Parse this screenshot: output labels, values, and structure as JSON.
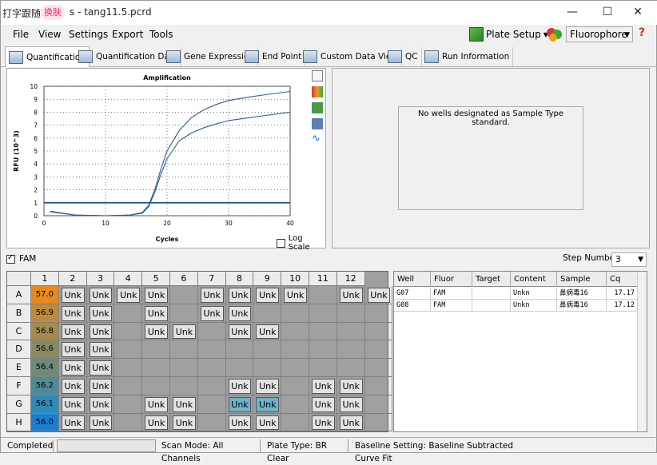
{
  "title": {
    "app_prefix": "打字跟随",
    "skin_pill": "换肤",
    "file": "s - tang11.5.pcrd"
  },
  "window_buttons": {
    "minimize": "—",
    "maximize": "☐",
    "close": "✕"
  },
  "menu": {
    "file": "File",
    "view": "View",
    "settings": "Settings",
    "export": "Export",
    "tools": "Tools"
  },
  "toolbar": {
    "plate_setup": "Plate Setup",
    "fluorophore": "Fluorophore",
    "help": "?"
  },
  "tabs": [
    "Quantification",
    "Quantification Data",
    "Gene Expression",
    "End Point",
    "Custom Data View",
    "QC",
    "Run Information"
  ],
  "chart": {
    "log_scale": "Log Scale"
  },
  "chart_data": {
    "type": "line",
    "title": "Amplification",
    "xlabel": "Cycles",
    "ylabel": "RFU (10^3)",
    "xlim": [
      0,
      40
    ],
    "ylim": [
      0,
      10
    ],
    "xticks": [
      0,
      10,
      20,
      30,
      40
    ],
    "yticks": [
      0,
      1,
      2,
      3,
      4,
      5,
      6,
      7,
      8,
      9,
      10
    ],
    "grid": true,
    "series": [
      {
        "x": [
          1,
          5,
          10,
          14,
          16,
          17,
          18,
          19,
          20,
          22,
          24,
          26,
          28,
          30,
          33,
          36,
          40
        ],
        "values": [
          0.35,
          0.05,
          0.0,
          0.05,
          0.25,
          0.8,
          2.0,
          3.6,
          5.0,
          6.6,
          7.6,
          8.2,
          8.6,
          8.9,
          9.15,
          9.35,
          9.6
        ]
      },
      {
        "x": [
          1,
          5,
          10,
          14,
          16,
          17,
          18,
          19,
          20,
          22,
          24,
          26,
          28,
          30,
          33,
          36,
          40
        ],
        "values": [
          0.3,
          0.05,
          0.0,
          0.05,
          0.2,
          0.7,
          1.8,
          3.2,
          4.4,
          5.8,
          6.4,
          6.8,
          7.1,
          7.35,
          7.55,
          7.75,
          8.0
        ]
      }
    ],
    "threshold": 1.0
  },
  "message": "No wells designated as Sample Type standard.",
  "fam_label": "FAM",
  "step_number": {
    "label": "Step Number:",
    "value": "3"
  },
  "plate": {
    "columns": [
      "1",
      "2",
      "3",
      "4",
      "5",
      "6",
      "7",
      "8",
      "9",
      "10",
      "11",
      "12"
    ],
    "rows": [
      {
        "letter": "A",
        "temp": "57.0",
        "color": "#e8891e",
        "wells": [
          "Unk",
          "Unk",
          "Unk",
          "Unk",
          "",
          "Unk",
          "Unk",
          "Unk",
          "Unk",
          "",
          "Unk",
          "Unk"
        ]
      },
      {
        "letter": "B",
        "temp": "56.9",
        "color": "#c08a3a",
        "wells": [
          "Unk",
          "Unk",
          "",
          "Unk",
          "",
          "Unk",
          "Unk",
          "",
          "",
          "",
          "",
          ""
        ]
      },
      {
        "letter": "C",
        "temp": "56.8",
        "color": "#a48a4e",
        "wells": [
          "Unk",
          "Unk",
          "",
          "Unk",
          "Unk",
          "",
          "Unk",
          "Unk",
          "",
          "",
          "",
          ""
        ]
      },
      {
        "letter": "D",
        "temp": "56.6",
        "color": "#8a8a62",
        "wells": [
          "Unk",
          "Unk",
          "",
          "",
          "",
          "",
          "",
          "",
          "",
          "",
          "",
          ""
        ]
      },
      {
        "letter": "E",
        "temp": "56.4",
        "color": "#6f8a78",
        "wells": [
          "Unk",
          "Unk",
          "",
          "",
          "",
          "",
          "",
          "",
          "",
          "",
          "",
          ""
        ]
      },
      {
        "letter": "F",
        "temp": "56.2",
        "color": "#4f8a98",
        "wells": [
          "Unk",
          "Unk",
          "",
          "",
          "",
          "",
          "Unk",
          "Unk",
          "",
          "Unk",
          "Unk",
          ""
        ]
      },
      {
        "letter": "G",
        "temp": "56.1",
        "color": "#2f8ab8",
        "wells": [
          "Unk",
          "Unk",
          "",
          "Unk",
          "Unk",
          "",
          "Unk",
          "Unk",
          "",
          "Unk",
          "Unk",
          ""
        ]
      },
      {
        "letter": "H",
        "temp": "56.0",
        "color": "#1a7fd0",
        "wells": [
          "Unk",
          "Unk",
          "",
          "Unk",
          "Unk",
          "",
          "Unk",
          "Unk",
          "",
          "Unk",
          "Unk",
          ""
        ]
      }
    ],
    "selected": [
      "G7",
      "G8"
    ]
  },
  "results": {
    "headers": [
      "Well",
      "Fluor",
      "Target",
      "Content",
      "Sample",
      "Cq"
    ],
    "rows": [
      [
        "G07",
        "FAM",
        "",
        "Unkn",
        "鼻病毒16",
        "17.17"
      ],
      [
        "G08",
        "FAM",
        "",
        "Unkn",
        "鼻病毒16",
        "17.12"
      ]
    ]
  },
  "status": {
    "completed": "Completed",
    "scan_mode": "Scan Mode: All Channels",
    "plate_type": "Plate Type: BR Clear",
    "baseline_prefix": "Baseline Setting: ",
    "baseline_value": "Baseline Subtracted Curve Fit"
  }
}
